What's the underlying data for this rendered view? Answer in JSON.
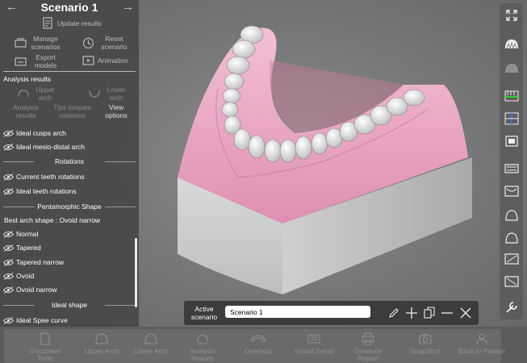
{
  "header": {
    "title": "Scenario 1"
  },
  "tools": {
    "update_results": "Update results",
    "manage_scenarios": "Manage scenarios",
    "reset_scenario": "Reset scenario",
    "export_models": "Export models",
    "animation": "Animation"
  },
  "analysis": {
    "heading": "Analysis results",
    "upper_arch": "Upper arch",
    "lower_arch": "Lower arch",
    "analysis_results": "Analysis results",
    "tips_torques": "Tips torques rotations",
    "view_options": "View options"
  },
  "list": {
    "ideal_cusps_arch": "Ideal cusps arch",
    "ideal_mesio_distal_arch": "Ideal mesio-distal arch",
    "rotations_header": "Rotations",
    "current_teeth_rotations": "Current teeth rotations",
    "ideal_teeth_rotations": "Ideal teeth rotations",
    "pentamorphic_header": "Pentamorphic Shape",
    "best_arch_shape": "Best arch shape : Ovoid narrow",
    "shapes": [
      "Normal",
      "Tapered",
      "Tapered narrow",
      "Ovoid",
      "Ovoid narrow"
    ],
    "ideal_shape_header": "Ideal shape",
    "ideal_spee_curve": "Ideal Spee curve"
  },
  "scenario_bar": {
    "label": "Active scenario",
    "value": "Scenario 1"
  },
  "bottom_bar": {
    "items": [
      "Document Tools",
      "Upper Arch",
      "Lower Arch",
      "Analysis Results",
      "Overlaps",
      "Virtual Setup",
      "Generate Report",
      "SnapShot",
      "Back to Patient"
    ]
  },
  "colors": {
    "gum": "#eaa6c4",
    "base": "#d6d6d6",
    "teeth": "#f2f2f2",
    "panel": "#484848"
  }
}
